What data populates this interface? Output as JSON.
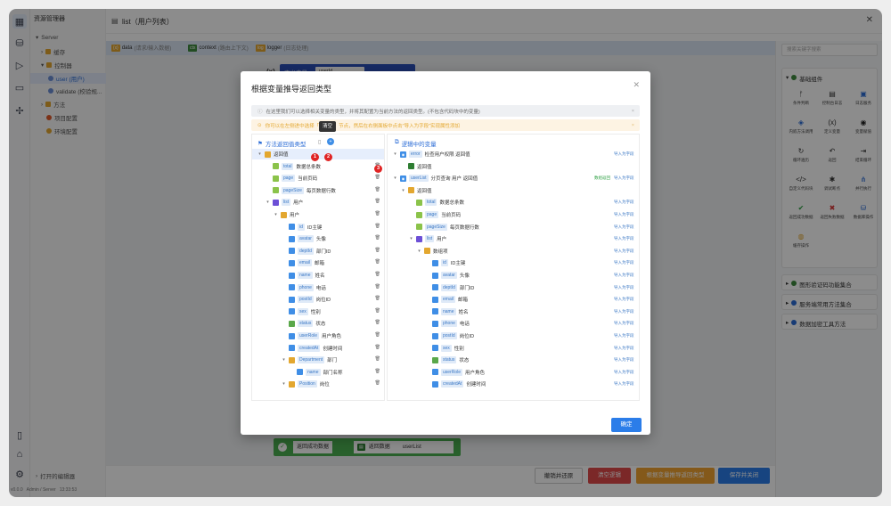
{
  "app": {
    "title": "资源管理器",
    "version": "v0.0.0",
    "user": "Admin / Server",
    "time": "13:33:53"
  },
  "tree": {
    "items": [
      {
        "label": "Server",
        "arrow": "▾"
      },
      {
        "label": "缓存",
        "arrow": "›"
      },
      {
        "label": "控制器",
        "arrow": "▾"
      },
      {
        "label": "user (用户)",
        "arrow": ""
      },
      {
        "label": "validate (校验规...",
        "arrow": ""
      },
      {
        "label": "方法",
        "arrow": "›"
      },
      {
        "label": "项目配置",
        "arrow": ""
      },
      {
        "label": "环境配置",
        "arrow": ""
      }
    ],
    "footer": "打开的编辑器"
  },
  "main": {
    "tab_title": "list（用户列表）",
    "context": [
      {
        "tag": "{x}",
        "name": "data",
        "desc": "(请求/输入数据)",
        "color": "#e3a72f"
      },
      {
        "tag": "ctx",
        "name": "context",
        "desc": "(路由上下文)",
        "color": "#3e8a3e"
      },
      {
        "tag": "log",
        "name": "logger",
        "desc": "(日志处理)",
        "color": "#e3a72f"
      }
    ],
    "var_label": "(x)",
    "var_def": "定义变量",
    "var_name": "userId",
    "return_node": {
      "label": "返回成功数据",
      "tag": "返回数据",
      "value": "userList"
    }
  },
  "right": {
    "search_placeholder": "搜索关键字搜索",
    "section": "基础组件",
    "components": [
      {
        "label": "条件判断",
        "icon": "ᚠ",
        "color": "#333"
      },
      {
        "label": "控制台日志",
        "icon": "▤",
        "color": "#333"
      },
      {
        "label": "日志服务",
        "icon": "▣",
        "color": "#2b6cd6"
      },
      {
        "label": "内嵌方法调用",
        "icon": "◈",
        "color": "#2b6cd6"
      },
      {
        "label": "定义变量",
        "icon": "(x)",
        "color": "#333"
      },
      {
        "label": "变量赋值",
        "icon": "◉",
        "color": "#222"
      },
      {
        "label": "循环遍历",
        "icon": "↻",
        "color": "#333"
      },
      {
        "label": "返回",
        "icon": "↶",
        "color": "#333"
      },
      {
        "label": "结束循环",
        "icon": "⇥",
        "color": "#333"
      },
      {
        "label": "自定义代码块",
        "icon": "</>",
        "color": "#333"
      },
      {
        "label": "调试断点",
        "icon": "✱",
        "color": "#333"
      },
      {
        "label": "并行执行",
        "icon": "⋔",
        "color": "#2b6cd6"
      },
      {
        "label": "返回成功数据",
        "icon": "✔",
        "color": "#2ea043"
      },
      {
        "label": "返回失败数据",
        "icon": "✖",
        "color": "#d93a3a"
      },
      {
        "label": "数据库操作",
        "icon": "⛁",
        "color": "#2b6cd6"
      },
      {
        "label": "缓存操作",
        "icon": "◍",
        "color": "#e3a72f"
      }
    ],
    "groups": [
      "图形验证码功能集合",
      "服务端常用方法集合",
      "数据加密工具方法"
    ]
  },
  "bottom": {
    "buttons": [
      {
        "label": "撤销并还原"
      },
      {
        "label": "清空逻辑"
      },
      {
        "label": "根据变量推导返回类型"
      },
      {
        "label": "保存并关闭"
      }
    ]
  },
  "modal": {
    "title": "根据变量推导返回类型",
    "info": "在这里我们可以选择相关变量的类型，并将其配置为当前方法的返回类型。(不包含代码块中的变量)",
    "warn": "你可以在左侧进中选择「返回值」节点，然后在右侧面板中点击\"导入为字段\"实现属性添加",
    "tooltip": "清空",
    "left_title": "方法返回值类型",
    "right_title": "逻辑中的变量",
    "confirm": "确定",
    "badges": [
      "1",
      "2",
      "3"
    ],
    "left_rows": [
      {
        "d": 0,
        "a": "▾",
        "t": "obj",
        "f": "",
        "l": "返回值"
      },
      {
        "d": 1,
        "a": "",
        "t": "num",
        "f": "total",
        "l": "数据总条数"
      },
      {
        "d": 1,
        "a": "",
        "t": "num",
        "f": "page",
        "l": "当前页码"
      },
      {
        "d": 1,
        "a": "",
        "t": "num",
        "f": "pageSize",
        "l": "每页数据行数"
      },
      {
        "d": 1,
        "a": "▾",
        "t": "arr",
        "f": "list",
        "l": "用户"
      },
      {
        "d": 2,
        "a": "▾",
        "t": "obj",
        "f": "",
        "l": "用户"
      },
      {
        "d": 3,
        "a": "",
        "t": "str",
        "f": "id",
        "l": "ID主键"
      },
      {
        "d": 3,
        "a": "",
        "t": "str",
        "f": "avatar",
        "l": "头像"
      },
      {
        "d": 3,
        "a": "",
        "t": "str",
        "f": "deptId",
        "l": "部门ID"
      },
      {
        "d": 3,
        "a": "",
        "t": "str",
        "f": "email",
        "l": "邮箱"
      },
      {
        "d": 3,
        "a": "",
        "t": "str",
        "f": "name",
        "l": "姓名"
      },
      {
        "d": 3,
        "a": "",
        "t": "str",
        "f": "phone",
        "l": "电话"
      },
      {
        "d": 3,
        "a": "",
        "t": "str",
        "f": "postId",
        "l": "岗位ID"
      },
      {
        "d": 3,
        "a": "",
        "t": "str",
        "f": "sex",
        "l": "性别"
      },
      {
        "d": 3,
        "a": "",
        "t": "bool",
        "f": "status",
        "l": "状态"
      },
      {
        "d": 3,
        "a": "",
        "t": "str",
        "f": "userRole",
        "l": "用户角色"
      },
      {
        "d": 3,
        "a": "",
        "t": "date",
        "f": "createdAt",
        "l": "创建时间"
      },
      {
        "d": 3,
        "a": "▾",
        "t": "obj",
        "f": "Department",
        "l": "部门"
      },
      {
        "d": 4,
        "a": "",
        "t": "str",
        "f": "name",
        "l": "部门名称"
      },
      {
        "d": 3,
        "a": "▾",
        "t": "obj",
        "f": "Position",
        "l": "岗位"
      }
    ],
    "right_rows": [
      {
        "d": 0,
        "a": "▾",
        "t": "ic",
        "f": "error",
        "l": "检查用户权限 返回值",
        "imp": "导入为字段"
      },
      {
        "d": 1,
        "a": "",
        "t": "ctx",
        "f": "",
        "l": "返回值",
        "imp": ""
      },
      {
        "d": 0,
        "a": "▾",
        "t": "ic",
        "f": "userList",
        "l": "分页查询 用户 返回值",
        "imp": "导入为字段",
        "imp2": "数组返回"
      },
      {
        "d": 1,
        "a": "▾",
        "t": "obj",
        "f": "",
        "l": "返回值",
        "imp": ""
      },
      {
        "d": 2,
        "a": "",
        "t": "num",
        "f": "total",
        "l": "数据总条数",
        "imp": "导入为字段"
      },
      {
        "d": 2,
        "a": "",
        "t": "num",
        "f": "page",
        "l": "当前页码",
        "imp": "导入为字段"
      },
      {
        "d": 2,
        "a": "",
        "t": "num",
        "f": "pageSize",
        "l": "每页数据行数",
        "imp": "导入为字段"
      },
      {
        "d": 2,
        "a": "▾",
        "t": "arr",
        "f": "list",
        "l": "用户",
        "imp": "导入为字段"
      },
      {
        "d": 3,
        "a": "▾",
        "t": "obj",
        "f": "",
        "l": "数组项",
        "imp": "导入为字段"
      },
      {
        "d": 4,
        "a": "",
        "t": "str",
        "f": "id",
        "l": "ID主键",
        "imp": "导入为字段"
      },
      {
        "d": 4,
        "a": "",
        "t": "str",
        "f": "avatar",
        "l": "头像",
        "imp": "导入为字段"
      },
      {
        "d": 4,
        "a": "",
        "t": "str",
        "f": "deptId",
        "l": "部门ID",
        "imp": "导入为字段"
      },
      {
        "d": 4,
        "a": "",
        "t": "str",
        "f": "email",
        "l": "邮箱",
        "imp": "导入为字段"
      },
      {
        "d": 4,
        "a": "",
        "t": "str",
        "f": "name",
        "l": "姓名",
        "imp": "导入为字段"
      },
      {
        "d": 4,
        "a": "",
        "t": "str",
        "f": "phone",
        "l": "电话",
        "imp": "导入为字段"
      },
      {
        "d": 4,
        "a": "",
        "t": "str",
        "f": "postId",
        "l": "岗位ID",
        "imp": "导入为字段"
      },
      {
        "d": 4,
        "a": "",
        "t": "str",
        "f": "sex",
        "l": "性别",
        "imp": "导入为字段"
      },
      {
        "d": 4,
        "a": "",
        "t": "bool",
        "f": "status",
        "l": "状态",
        "imp": "导入为字段"
      },
      {
        "d": 4,
        "a": "",
        "t": "str",
        "f": "userRole",
        "l": "用户角色",
        "imp": "导入为字段"
      },
      {
        "d": 4,
        "a": "",
        "t": "date",
        "f": "createdAt",
        "l": "创建时间",
        "imp": "导入为字段"
      }
    ],
    "type_colors": {
      "obj": "#e3a72f",
      "num": "#8bc34a",
      "arr": "#6c4fd6",
      "str": "#3f8ee6",
      "bool": "#5aa84a",
      "date": "#3f8ee6",
      "ctx": "#2e7d32",
      "ic": "#3f8ee6"
    }
  }
}
